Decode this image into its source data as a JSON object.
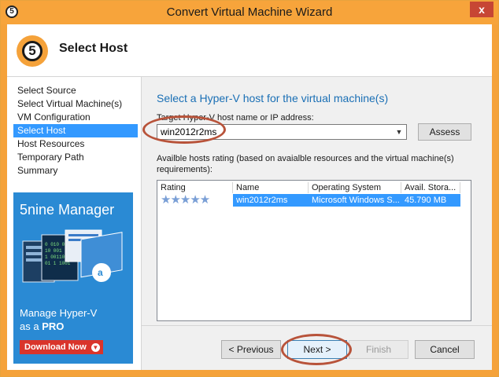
{
  "window": {
    "title": "Convert Virtual Machine Wizard",
    "close_glyph": "x",
    "app_icon_text": "5"
  },
  "header": {
    "step_number": "5",
    "title": "Select Host"
  },
  "nav": {
    "items": [
      {
        "label": "Select Source",
        "selected": false
      },
      {
        "label": "Select Virtual Machine(s)",
        "selected": false
      },
      {
        "label": "VM Configuration",
        "selected": false
      },
      {
        "label": "Select Host",
        "selected": true
      },
      {
        "label": "Host Resources",
        "selected": false
      },
      {
        "label": "Temporary Path",
        "selected": false
      },
      {
        "label": "Summary",
        "selected": false
      }
    ]
  },
  "ad": {
    "title": "5nine Manager",
    "line1": "Manage Hyper-V",
    "line2_prefix": "as a ",
    "line2_bold": "PRO",
    "button": "Download Now"
  },
  "main": {
    "heading": "Select a Hyper-V host for the virtual machine(s)",
    "host_label": "Target Hyper-V host name or IP address:",
    "host_value": "win2012r2ms",
    "assess_label": "Assess",
    "rating_desc": "Availble hosts rating (based on avaialble resources and the virtual machine(s) requirements):"
  },
  "grid": {
    "columns": [
      "Rating",
      "Name",
      "Operating System",
      "Avail. Stora..."
    ],
    "rows": [
      {
        "rating": 5,
        "name": "win2012r2ms",
        "os": "Microsoft Windows S...",
        "storage": "45.790 MB"
      }
    ]
  },
  "footer": {
    "previous": "< Previous",
    "next": "Next >",
    "finish": "Finish",
    "cancel": "Cancel"
  },
  "colors": {
    "accent": "#f5a23a",
    "selection": "#3399ff",
    "heading": "#1a6fb5",
    "annotation": "#b8533a"
  }
}
